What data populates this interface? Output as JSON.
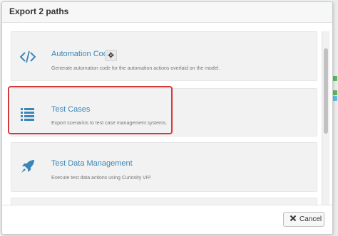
{
  "modal": {
    "title": "Export 2 paths"
  },
  "options": [
    {
      "title": "Automation Code",
      "description": "Generate automation code for the automation actions overlaid on the model.",
      "icon": "code-icon",
      "has_settings": true
    },
    {
      "title": "Test Cases",
      "description": "Export scenarios to test case management systems.",
      "icon": "list-icon",
      "highlighted": true
    },
    {
      "title": "Test Data Management",
      "description": "Execute test data actions using Curiosity VIP.",
      "icon": "rocket-icon"
    }
  ],
  "footer": {
    "cancel_label": "Cancel"
  },
  "colors": {
    "accent": "#3a86b8",
    "highlight": "#d6393b",
    "card_bg": "#f2f2f2"
  }
}
